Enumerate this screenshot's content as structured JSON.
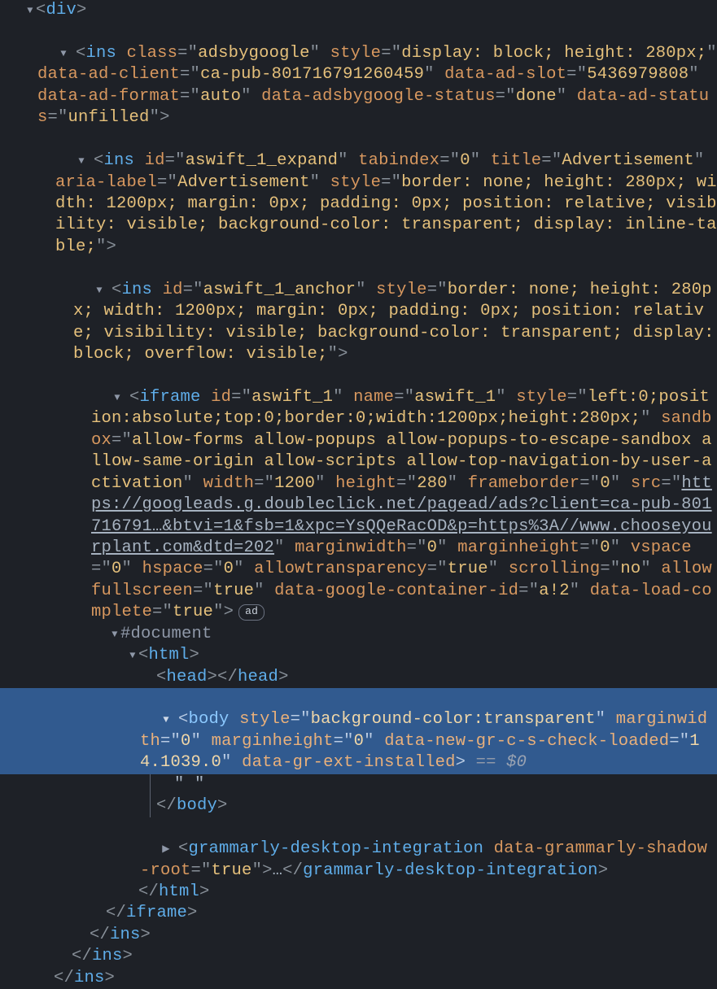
{
  "l0": {
    "t": "div"
  },
  "l1": {
    "t": "ins",
    "a_class": "class",
    "v_class": "adsbygoogle",
    "a_style": "style",
    "v_style": "display: block; height: 280px;",
    "a_dac": "data-ad-client",
    "v_dac": "ca-pub-801716791260459",
    "a_das": "data-ad-slot",
    "v_das": "5436979808",
    "a_daf": "data-ad-format",
    "v_daf": "auto",
    "a_dags": "data-adsbygoogle-status",
    "v_dags": "done",
    "a_dast": "data-ad-status",
    "v_dast": "unfilled"
  },
  "l2": {
    "t": "ins",
    "a_id": "id",
    "v_id": "aswift_1_expand",
    "a_tab": "tabindex",
    "v_tab": "0",
    "a_title": "title",
    "v_title": "Advertisement",
    "a_al": "aria-label",
    "v_al": "Advertisement",
    "a_style": "style",
    "v_style": "border: none; height: 280px; width: 1200px; margin: 0px; padding: 0px; position: relative; visibility: visible; background-color: transparent; display: inline-table;"
  },
  "l3": {
    "t": "ins",
    "a_id": "id",
    "v_id": "aswift_1_anchor",
    "a_style": "style",
    "v_style": "border: none; height: 280px; width: 1200px; margin: 0px; padding: 0px; position: relative; visibility: visible; background-color: transparent; display: block; overflow: visible;"
  },
  "l4": {
    "t": "iframe",
    "a_id": "id",
    "v_id": "aswift_1",
    "a_name": "name",
    "v_name": "aswift_1",
    "a_style": "style",
    "v_style": "left:0;position:absolute;top:0;border:0;width:1200px;height:280px;",
    "a_sb": "sandbox",
    "v_sb": "allow-forms allow-popups allow-popups-to-escape-sandbox allow-same-origin allow-scripts allow-top-navigation-by-user-activation",
    "a_w": "width",
    "v_w": "1200",
    "a_h": "height",
    "v_h": "280",
    "a_fb": "frameborder",
    "v_fb": "0",
    "a_src": "src",
    "v_src": "https://googleads.g.doubleclick.net/pagead/ads?client=ca-pub-801716791…&btvi=1&fsb=1&xpc=YsQQeRacOD&p=https%3A//www.chooseyourplant.com&dtd=202",
    "a_mw": "marginwidth",
    "v_mw": "0",
    "a_mh": "marginheight",
    "v_mh": "0",
    "a_vs": "vspace",
    "v_vs": "0",
    "a_hs": "hspace",
    "v_hs": "0",
    "a_at": "allowtransparency",
    "v_at": "true",
    "a_sc": "scrolling",
    "v_sc": "no",
    "a_af": "allowfullscreen",
    "v_af": "true",
    "a_gc": "data-google-container-id",
    "v_gc": "a!2",
    "a_lc": "data-load-complete",
    "v_lc": "true",
    "badge": "ad"
  },
  "l5": {
    "doc": "#document"
  },
  "l6": {
    "t": "html"
  },
  "l7": {
    "t": "head"
  },
  "l8": {
    "t": "body",
    "a_style": "style",
    "v_style": "background-color:transparent",
    "a_mw": "marginwidth",
    "v_mw": "0",
    "a_mh": "marginheight",
    "v_mh": "0",
    "a_gr1": "data-new-gr-c-s-check-loaded",
    "v_gr1": "14.1039.0",
    "a_gr2": "data-gr-ext-installed",
    "eqeq": " == ",
    "sel": "$0"
  },
  "l9": {
    "txt": "\" \""
  },
  "l10": {
    "t": "body"
  },
  "l11": {
    "t": "grammarly-desktop-integration",
    "a_a": "data-grammarly-shadow-root",
    "v_a": "true",
    "ell": "…"
  },
  "l12": {
    "t": "html"
  },
  "l13": {
    "t": "iframe"
  },
  "l14": {
    "t": "ins"
  },
  "l15": {
    "t": "ins"
  },
  "l16": {
    "t": "ins"
  }
}
